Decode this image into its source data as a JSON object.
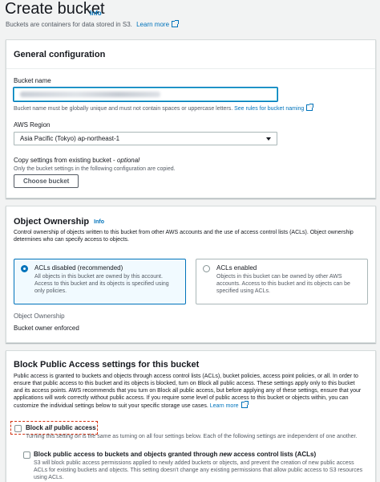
{
  "header": {
    "title": "Create bucket",
    "info_label": "Info",
    "subtitle": "Buckets are containers for data stored in S3.",
    "learn_more": "Learn more"
  },
  "general": {
    "title": "General configuration",
    "bucket_name_label": "Bucket name",
    "bucket_name_hint": "Bucket name must be globally unique and must not contain spaces or uppercase letters.",
    "naming_rules_link": "See rules for bucket naming",
    "region_label": "AWS Region",
    "region_value": "Asia Pacific (Tokyo) ap-northeast-1",
    "copy_label": "Copy settings from existing bucket -",
    "copy_optional": "optional",
    "copy_hint": "Only the bucket settings in the following configuration are copied.",
    "choose_button": "Choose bucket"
  },
  "ownership": {
    "title": "Object Ownership",
    "info_label": "Info",
    "description": [
      "Control ownership of objects written to this bucket from other AWS accounts and the use of access control lists (ACLs). Object ownership",
      "determines who can specify access to objects."
    ],
    "options": [
      {
        "title": "ACLs disabled (recommended)",
        "description": [
          "All objects in this bucket are owned by this account.",
          "Access to this bucket and its objects is specified using",
          "only policies."
        ],
        "selected": true
      },
      {
        "title": "ACLs enabled",
        "description": [
          "Objects in this bucket can be owned by other AWS",
          "accounts. Access to this bucket and its objects can be",
          "specified using ACLs."
        ],
        "selected": false
      }
    ],
    "field_label": "Object Ownership",
    "field_value": "Bucket owner enforced"
  },
  "public_access": {
    "title": "Block Public Access settings for this bucket",
    "description": [
      "Public access is granted to buckets and objects through access control lists (ACLs), bucket policies, access point policies, or all. In order to",
      "ensure that public access to this bucket and its objects is blocked, turn on Block all public access. These settings apply only to this bucket",
      "and its access points. AWS recommends that you turn on Block all public access, but before applying any of these settings, ensure that your",
      "applications will work correctly without public access. If you require some level of public access to this bucket or objects within, you can",
      "customize the individual settings below to suit your specific storage use cases."
    ],
    "learn_more": "Learn more",
    "block_all": {
      "label_pre": "Block",
      "label_em": "all",
      "label_post": "public access",
      "description": "Turning this setting on is the same as turning on all four settings below. Each of the following settings are independent of one another.",
      "checked": false
    },
    "block_new_acls": {
      "label_pre": "Block public access to buckets and objects granted through",
      "label_em": "new",
      "label_post": "access control lists (ACLs)",
      "description": [
        "S3 will block public access permissions applied to newly added buckets or objects, and prevent the creation of new public access",
        "ACLs for existing buckets and objects. This setting doesn't change any existing permissions that allow public access to S3 resources",
        "using ACLs."
      ],
      "checked": false
    }
  },
  "colors": {
    "link": "#0073bb",
    "highlight_dashed": "#d13212",
    "selected_tile_bg": "#f1faff"
  }
}
